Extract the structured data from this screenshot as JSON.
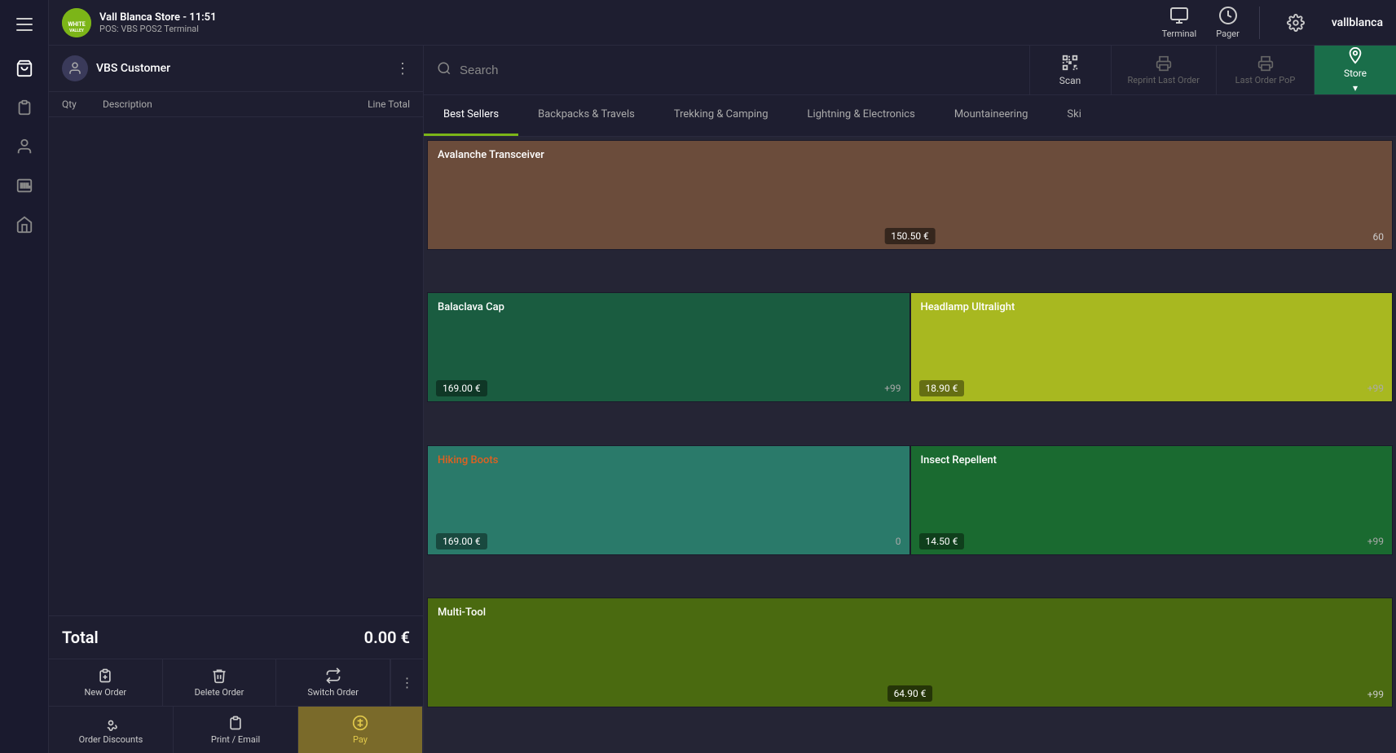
{
  "app": {
    "logo_text": "WHITE VALLEY",
    "store_name": "Vall Blanca Store - 11:51",
    "pos_info": "POS: VBS POS2 Terminal",
    "user_name": "vallblanca"
  },
  "header": {
    "terminal_label": "Terminal",
    "pager_label": "Pager",
    "store_label": "Store"
  },
  "order_panel": {
    "customer_name": "VBS Customer",
    "col_qty": "Qty",
    "col_desc": "Description",
    "col_line_total": "Line Total",
    "total_label": "Total",
    "total_amount": "0.00 €"
  },
  "action_buttons": {
    "new_order": "New Order",
    "delete_order": "Delete Order",
    "switch_order": "Switch Order",
    "order_discounts": "Order Discounts",
    "print_email": "Print / Email",
    "pay": "Pay"
  },
  "search": {
    "placeholder": "Search",
    "scan_label": "Scan",
    "reprint_label": "Reprint Last Order",
    "last_order_label": "Last Order PoP",
    "store_label": "Store"
  },
  "categories": [
    {
      "id": "best-sellers",
      "label": "Best Sellers",
      "active": true
    },
    {
      "id": "backpacks-travels",
      "label": "Backpacks & Travels",
      "active": false
    },
    {
      "id": "trekking-camping",
      "label": "Trekking & Camping",
      "active": false
    },
    {
      "id": "lightning-electronics",
      "label": "Lightning & Electronics",
      "active": false
    },
    {
      "id": "mountaineering",
      "label": "Mountaineering",
      "active": false
    },
    {
      "id": "ski",
      "label": "Ski",
      "active": false
    }
  ],
  "products": [
    {
      "id": "avalanche-transceiver",
      "name": "Avalanche Transceiver",
      "price": "150.50 €",
      "qty": "60",
      "color": "brown",
      "width": "full"
    },
    {
      "id": "balaclava-cap",
      "name": "Balaclava Cap",
      "price": "169.00 €",
      "qty": "+99",
      "color": "dark-green",
      "width": "half"
    },
    {
      "id": "headlamp-ultralight",
      "name": "Headlamp Ultralight",
      "price": "18.90 €",
      "qty": "+99",
      "color": "yellow-green",
      "width": "half"
    },
    {
      "id": "hiking-boots",
      "name": "Hiking Boots",
      "price": "169.00 €",
      "qty": "0",
      "color": "teal",
      "width": "half",
      "name_color": "orange"
    },
    {
      "id": "insect-repellent",
      "name": "Insect Repellent",
      "price": "14.50 €",
      "qty": "+99",
      "color": "green",
      "width": "half"
    },
    {
      "id": "multi-tool",
      "name": "Multi-Tool",
      "price": "64.90 €",
      "qty": "+99",
      "color": "olive",
      "width": "full"
    }
  ]
}
